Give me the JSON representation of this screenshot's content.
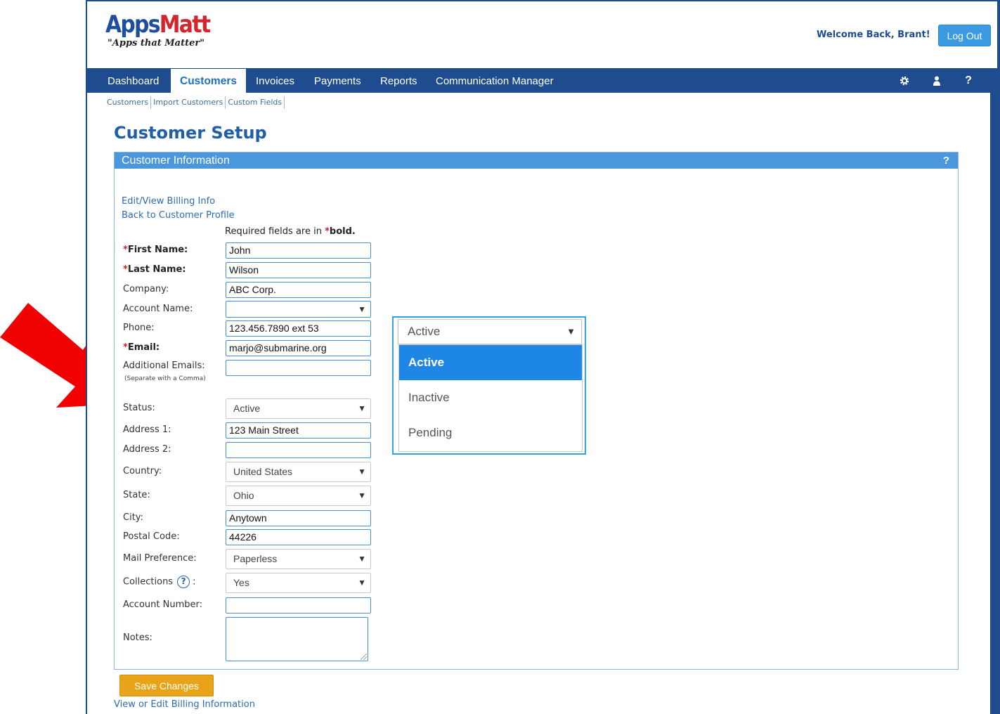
{
  "header": {
    "logo_apps": "Apps",
    "logo_matt": "Matt",
    "tagline": "\"Apps that Matter\"",
    "welcome": "Welcome Back, Brant!",
    "logout_label": "Log Out"
  },
  "nav": {
    "items": [
      {
        "label": "Dashboard"
      },
      {
        "label": "Customers"
      },
      {
        "label": "Invoices"
      },
      {
        "label": "Payments"
      },
      {
        "label": "Reports"
      },
      {
        "label": "Communication Manager"
      }
    ],
    "icons": [
      "gear-icon",
      "user-icon",
      "help-icon"
    ],
    "help_glyph": "?"
  },
  "subnav": {
    "items": [
      "Customers",
      "Import Customers",
      "Custom Fields"
    ]
  },
  "page_title": "Customer Setup",
  "panel": {
    "title": "Customer Information",
    "help": "?",
    "link_billing": "Edit/View Billing Info",
    "link_profile": "Back to Customer Profile",
    "required_prefix": "Required fields are in ",
    "required_star": "*",
    "required_bold": "bold."
  },
  "form": {
    "first_name": {
      "label": "First Name:",
      "value": "John"
    },
    "last_name": {
      "label": "Last Name:",
      "value": "Wilson"
    },
    "company": {
      "label": "Company:",
      "value": "ABC Corp."
    },
    "account_name": {
      "label": "Account Name:",
      "value": ""
    },
    "phone": {
      "label": "Phone:",
      "value": "123.456.7890 ext 53"
    },
    "email": {
      "label": "Email:",
      "value": "marjo@submarine.org"
    },
    "additional_emails": {
      "label": "Additional Emails:",
      "hint": "(Separate with a Comma)",
      "value": ""
    },
    "status": {
      "label": "Status:",
      "value": "Active"
    },
    "address1": {
      "label": "Address 1:",
      "value": "123 Main Street"
    },
    "address2": {
      "label": "Address 2:",
      "value": ""
    },
    "country": {
      "label": "Country:",
      "value": "United States"
    },
    "state": {
      "label": "State:",
      "value": "Ohio"
    },
    "city": {
      "label": "City:",
      "value": "Anytown"
    },
    "postal_code": {
      "label": "Postal Code:",
      "value": "44226"
    },
    "mail_preference": {
      "label": "Mail Preference:",
      "value": "Paperless"
    },
    "collections": {
      "label": "Collections",
      "suffix": ":",
      "help": "?",
      "value": "Yes"
    },
    "account_number": {
      "label": "Account Number:",
      "value": ""
    },
    "notes": {
      "label": "Notes:",
      "value": ""
    },
    "required_star": "*",
    "select_arrow": "▼"
  },
  "status_dropdown": {
    "selected": "Active",
    "options": [
      "Active",
      "Inactive",
      "Pending"
    ]
  },
  "footer": {
    "save_label": "Save Changes",
    "billing_link": "View or Edit Billing Information"
  },
  "colors": {
    "brand_blue": "#1f4c8f",
    "accent_blue": "#4a97dd",
    "save_orange": "#e8a318",
    "annotation_arrow": "#f00000",
    "highlight_border": "#2fa6d9"
  }
}
